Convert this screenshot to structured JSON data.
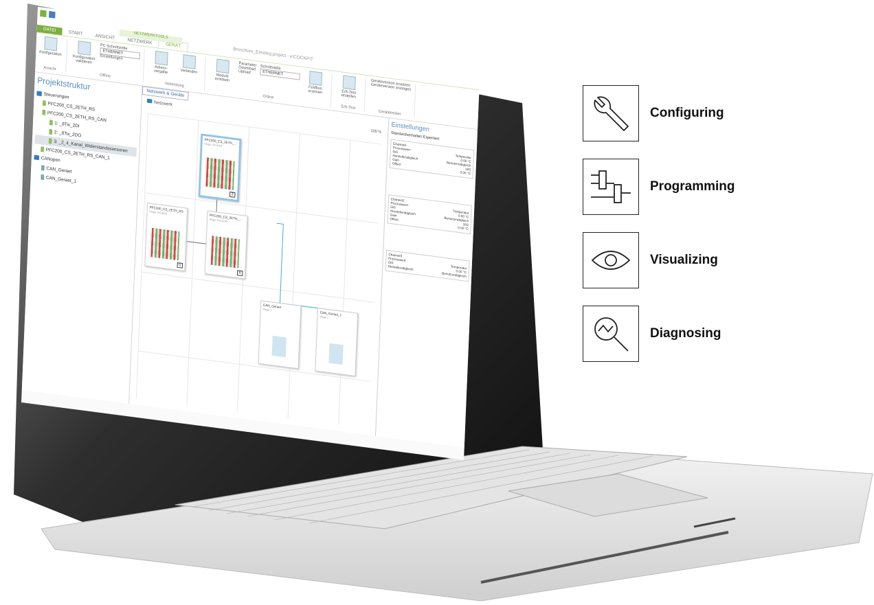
{
  "app": {
    "ribbon_tabs": [
      "DATEI",
      "START",
      "ANSICHT",
      "NETZWERK",
      "GERÄT"
    ],
    "context_group": "NETZWERKTOOLS",
    "doc_title": "Broschüre_Einstieg.project - e!COCKPIT",
    "ribbon": {
      "konfiguration": "Konfiguration",
      "ansicht": "Ansicht",
      "konfiguration_validieren": "Konfiguration validieren",
      "offline": "Offline",
      "pc_schnittstelle": "PC-Schnittstelle",
      "pc_schnittstelle_value": "ETHERNET",
      "einstellungen": "Einstellungen",
      "adressvergabe": "Adress-vergabe",
      "verbinden": "Verbinden",
      "verbindung": "Verbindung",
      "module_ermitteln": "Module ermitteln",
      "parameter": "Parameter",
      "download": "Download",
      "upload": "Upload",
      "schnittstelle": "Schnittstelle",
      "schnittstelle_value": "ETHERNET",
      "online": "Online",
      "feldbus_scannen": "Feldbus scannen",
      "ea_test_erstellen": "E/A-Test erstellen",
      "ea_test": "E/A-Test",
      "geraeteversion_ersetzen": "Geräteversion ersetzen",
      "geraeteversion_anzeigen": "Geräteversion anzeigen",
      "geraetetreiber": "Gerätetreiber"
    },
    "tree": {
      "title": "Projektstruktur",
      "nodes": [
        "Steuerungen",
        "PFC200_CS_2ETH_RS",
        "PFC200_CS_2ETH_RS_CAN",
        "1: _8Tix_2DI",
        "2: _8Tix_2DO",
        "3: _2_4_Kanal_Widerstandssensoren",
        "PFC200_CS_2ETH_RS_CAN_1",
        "CANopen",
        "CAN_Geraet",
        "CAN_Geraet_1"
      ]
    },
    "network": {
      "tab": "Netzwerk & Geräte",
      "breadcrumb": "Netzwerk",
      "zoom": "100 %",
      "devices": [
        {
          "name": "PFC200_CS_2ETH_...",
          "sub": "Wago 750-8204",
          "num": "3"
        },
        {
          "name": "PFC200_CS_2ETH_RS",
          "sub": "Wago 750-8202",
          "num": "5"
        },
        {
          "name": "PFC200_CS_2ETH_...",
          "sub": "Wago 750-8204",
          "num": "6"
        },
        {
          "name": "CAN_Geraet",
          "sub": "Wago 1",
          "num": ""
        },
        {
          "name": "CAN_Geraet_1",
          "sub": "Wago 1",
          "num": ""
        }
      ]
    },
    "settings": {
      "title": "Einstellungen",
      "standard": "Standardverhalten Expertiert",
      "channels": [
        {
          "name": "Channel1",
          "prozesswert": "Prozesswert",
          "temperatur": "Temperatur",
          "v0": "0x0",
          "v1": "0.00 °C",
          "hersteller": "Herstellerabgleich",
          "benutzer": "Benutzerabgleich",
          "gain": "Gain",
          "gv": "16S",
          "offset": "Offset",
          "ov": "0.00 °C"
        },
        {
          "name": "Channel2",
          "prozesswert": "Prozesswert",
          "temperatur": "Temperatur",
          "v0": "0x0",
          "v1": "0.00 °C",
          "hersteller": "Herstellerabgleich",
          "benutzer": "Benutzerabgleich",
          "gain": "Gain",
          "gv": "16S",
          "offset": "Offset",
          "ov": "0.00 °C"
        },
        {
          "name": "Channel3",
          "prozesswert": "Prozesswert",
          "temperatur": "Temperatur",
          "v0": "0x0",
          "v1": "0.00 °C",
          "hersteller": "Herstellerabgleich",
          "benutzer": "Benutzerabgleich",
          "gain": "",
          "gv": "",
          "offset": "",
          "ov": ""
        }
      ]
    }
  },
  "features": [
    {
      "label": "Configuring",
      "icon": "wrench-icon"
    },
    {
      "label": "Programming",
      "icon": "ladder-logic-icon"
    },
    {
      "label": "Visualizing",
      "icon": "eye-icon"
    },
    {
      "label": "Diagnosing",
      "icon": "magnifier-signal-icon"
    }
  ],
  "colors": {
    "accent": "#7bb03a",
    "blue": "#2d7fc6",
    "link": "#3aa0e0"
  }
}
